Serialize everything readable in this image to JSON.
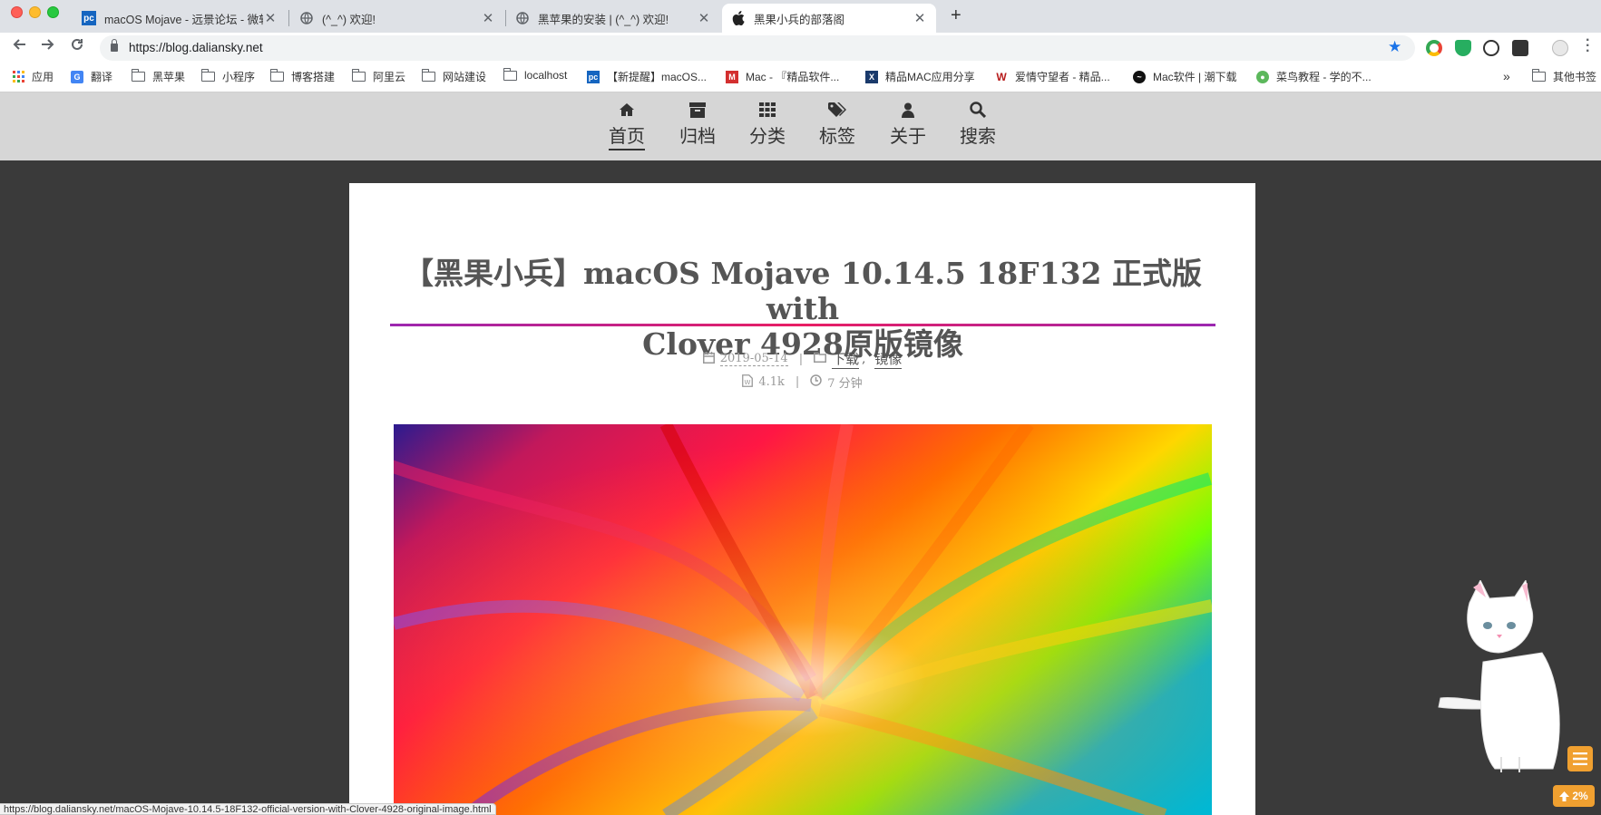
{
  "tabs": [
    {
      "title": "macOS Mojave - 远景论坛 - 微软",
      "favicon": "pc-logo-icon"
    },
    {
      "title": "(^_^) 欢迎!",
      "favicon": "globe-icon"
    },
    {
      "title": "黑苹果的安装 | (^_^) 欢迎!",
      "favicon": "globe-icon"
    },
    {
      "title": "黑果小兵的部落阁",
      "favicon": "apple-icon",
      "active": true
    }
  ],
  "address_bar": {
    "url": "https://blog.daliansky.net"
  },
  "bookmarks": [
    {
      "label": "应用",
      "icon": "apps-grid-icon"
    },
    {
      "label": "翻译",
      "icon": "translate-icon"
    },
    {
      "label": "黑苹果",
      "icon": "folder-icon"
    },
    {
      "label": "小程序",
      "icon": "folder-icon"
    },
    {
      "label": "博客搭建",
      "icon": "folder-icon"
    },
    {
      "label": "阿里云",
      "icon": "folder-icon"
    },
    {
      "label": "网站建设",
      "icon": "folder-icon"
    },
    {
      "label": "localhost",
      "icon": "folder-icon"
    },
    {
      "label": "【新提醒】macOS...",
      "icon": "pc-logo-icon"
    },
    {
      "label": "Mac - 『精品软件...",
      "icon": "mac-site-icon"
    },
    {
      "label": "精品MAC应用分享",
      "icon": "x-logo-icon"
    },
    {
      "label": "爱情守望者 - 精品...",
      "icon": "w-logo-icon"
    },
    {
      "label": "Mac软件 | 潮下载",
      "icon": "wave-icon"
    },
    {
      "label": "菜鸟教程 - 学的不...",
      "icon": "runoob-icon"
    }
  ],
  "bookmarks_more": "»",
  "other_bookmarks": "其他书签",
  "site_nav": [
    {
      "label": "首页",
      "icon": "home-icon",
      "active": true
    },
    {
      "label": "归档",
      "icon": "archive-icon"
    },
    {
      "label": "分类",
      "icon": "grid-icon"
    },
    {
      "label": "标签",
      "icon": "tags-icon"
    },
    {
      "label": "关于",
      "icon": "user-icon"
    },
    {
      "label": "搜索",
      "icon": "search-icon"
    }
  ],
  "post": {
    "title_line1": "【黑果小兵】macOS Mojave 10.14.5 18F132 正式版 with",
    "title_line2": "Clover 4928原版镜像",
    "date": "2019-05-14",
    "categories": [
      "下载",
      "镜像"
    ],
    "category_sep": ",",
    "meta_sep": "|",
    "word_count": "4.1k",
    "read_time": "7 分钟"
  },
  "status_bar": {
    "url": "https://blog.daliansky.net/macOS-Mojave-10.14.5-18F132-official-version-with-Clover-4928-original-image.html"
  },
  "back_to_top": {
    "label": "2%"
  },
  "colors": {
    "accent": "#f0a030",
    "nav_bg": "#d6d6d6",
    "page_bg": "#3a3a3a",
    "title_underline": "#e91e63"
  }
}
